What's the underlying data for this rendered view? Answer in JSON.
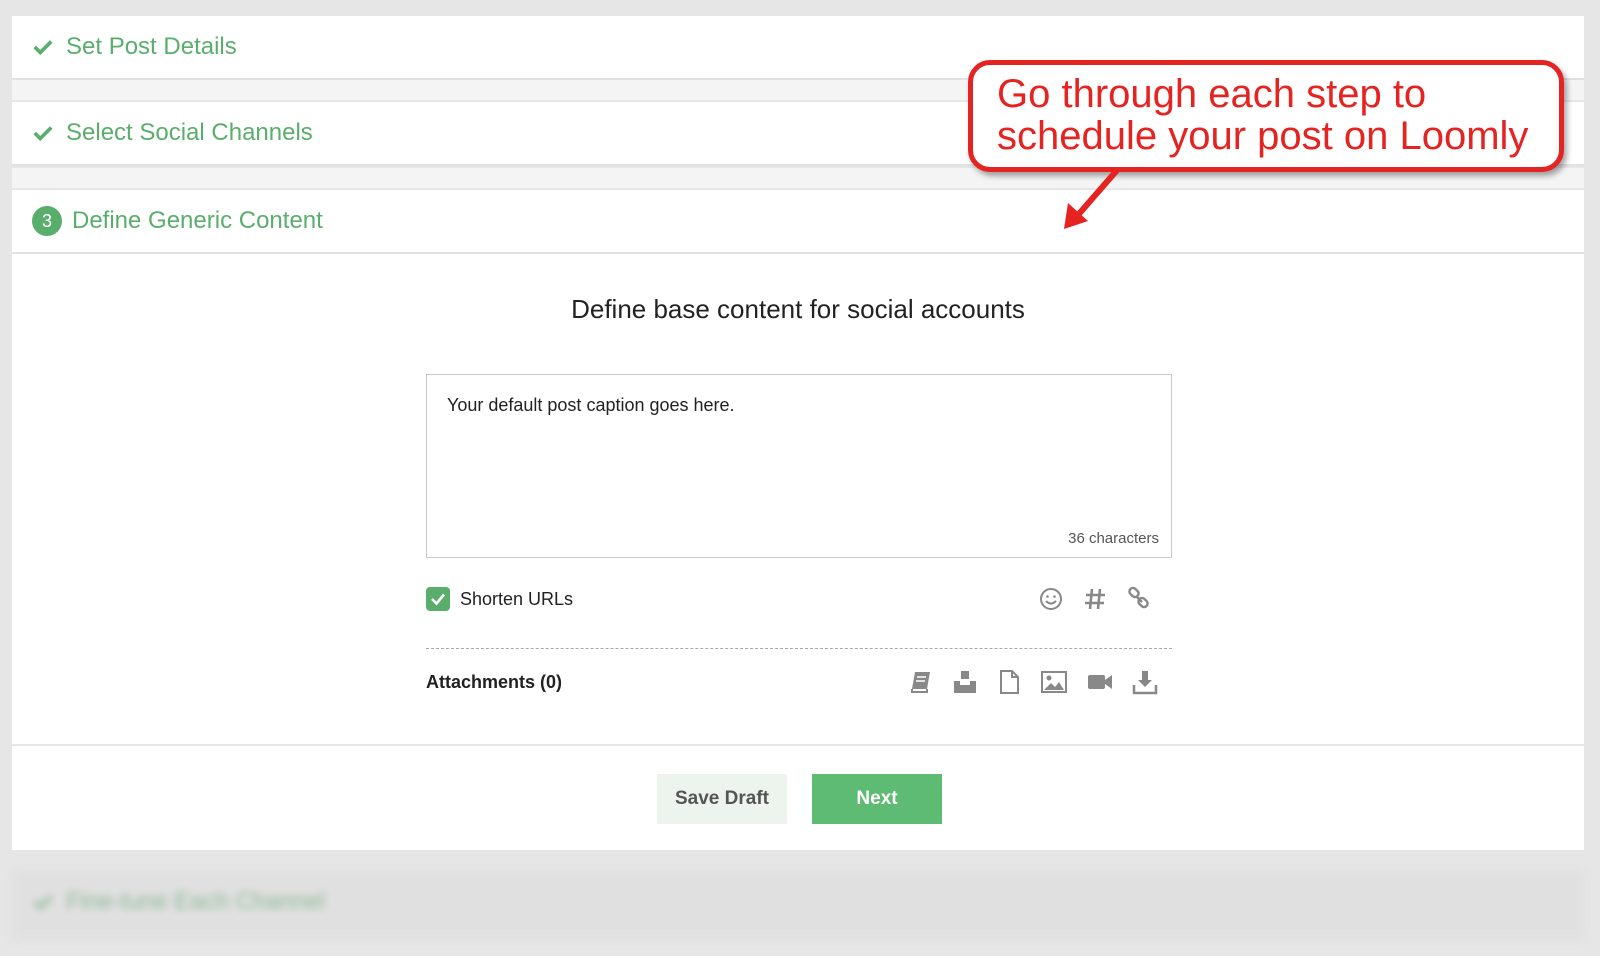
{
  "steps": [
    {
      "label": "Set Post Details",
      "status": "complete"
    },
    {
      "label": "Select Social Channels",
      "status": "complete"
    },
    {
      "label": "Define Generic Content",
      "status": "active",
      "number": "3"
    },
    {
      "label": "Fine-tune Each Channel",
      "status": "complete"
    }
  ],
  "content": {
    "title": "Define base content for social accounts",
    "caption": "Your default post caption goes here.",
    "char_count": "36 characters",
    "shorten_urls_label": "Shorten URLs",
    "shorten_urls_checked": true,
    "attachments_label": "Attachments (0)"
  },
  "buttons": {
    "save_draft": "Save Draft",
    "next": "Next"
  },
  "callout": {
    "line1": "Go through each step to",
    "line2": "schedule your post on Loomly"
  },
  "icons": {
    "tools": [
      "emoji-icon",
      "hashtag-icon",
      "link-icon"
    ],
    "attachments": [
      "library-icon",
      "upload-icon",
      "document-icon",
      "image-icon",
      "video-icon",
      "download-icon"
    ]
  },
  "colors": {
    "accent_green": "#5aae6c",
    "callout_red": "#e52421"
  }
}
